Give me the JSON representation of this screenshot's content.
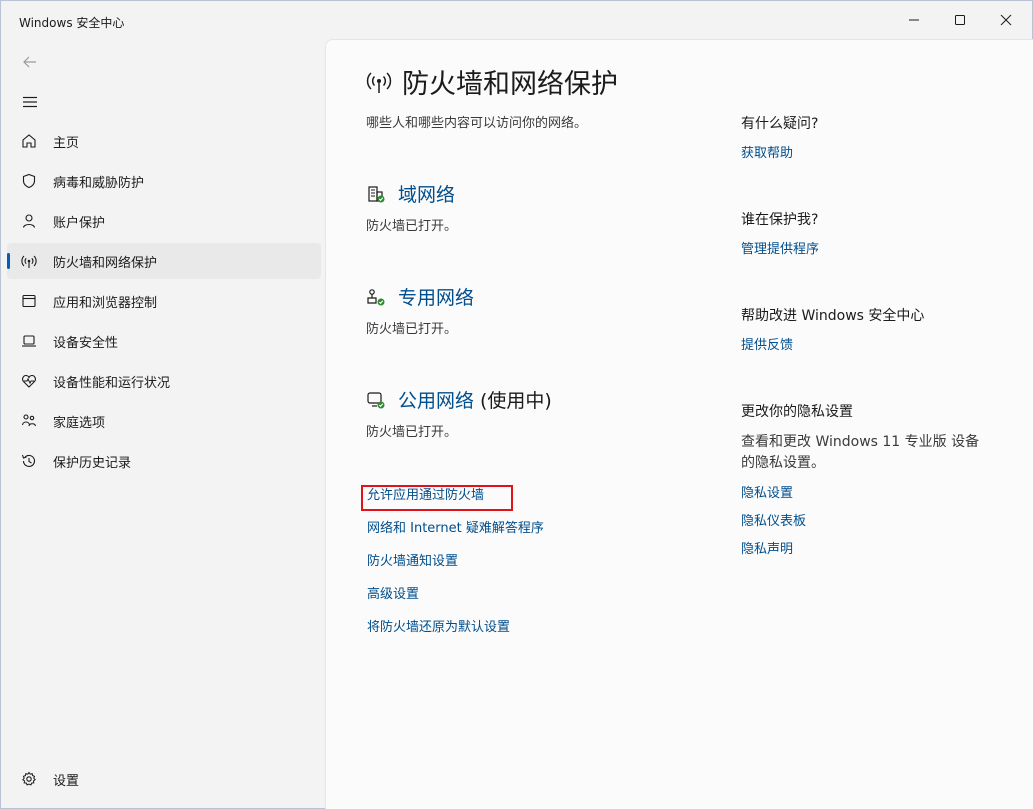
{
  "window": {
    "title": "Windows 安全中心"
  },
  "sidebar": {
    "items": [
      {
        "label": "主页",
        "icon": "home-icon"
      },
      {
        "label": "病毒和威胁防护",
        "icon": "shield-icon"
      },
      {
        "label": "账户保护",
        "icon": "person-icon"
      },
      {
        "label": "防火墙和网络保护",
        "icon": "wifi-antenna-icon",
        "active": true
      },
      {
        "label": "应用和浏览器控制",
        "icon": "app-window-icon"
      },
      {
        "label": "设备安全性",
        "icon": "laptop-icon"
      },
      {
        "label": "设备性能和运行状况",
        "icon": "heart-pulse-icon"
      },
      {
        "label": "家庭选项",
        "icon": "family-icon"
      },
      {
        "label": "保护历史记录",
        "icon": "history-icon"
      }
    ],
    "settings_label": "设置"
  },
  "main": {
    "title": "防火墙和网络保护",
    "subtitle": "哪些人和哪些内容可以访问你的网络。",
    "networks": [
      {
        "name": "域网络",
        "extra": "",
        "status": "防火墙已打开。",
        "icon": "domain-network-icon"
      },
      {
        "name": "专用网络",
        "extra": "",
        "status": "防火墙已打开。",
        "icon": "private-network-icon"
      },
      {
        "name": "公用网络",
        "extra": "(使用中)",
        "status": "防火墙已打开。",
        "icon": "public-network-icon"
      }
    ],
    "links": [
      "允许应用通过防火墙",
      "网络和 Internet 疑难解答程序",
      "防火墙通知设置",
      "高级设置",
      "将防火墙还原为默认设置"
    ]
  },
  "aside": {
    "question_heading": "有什么疑问?",
    "get_help": "获取帮助",
    "protector_heading": "谁在保护我?",
    "manage_providers": "管理提供程序",
    "improve_heading": "帮助改进 Windows 安全中心",
    "feedback": "提供反馈",
    "privacy_heading": "更改你的隐私设置",
    "privacy_text": "查看和更改 Windows 11 专业版 设备的隐私设置。",
    "privacy_settings": "隐私设置",
    "privacy_dashboard": "隐私仪表板",
    "privacy_statement": "隐私声明"
  },
  "colors": {
    "accent": "#005fb8",
    "link": "#004e8c",
    "highlight_box": "#e0131a",
    "ok_green": "#2e8b2e"
  }
}
